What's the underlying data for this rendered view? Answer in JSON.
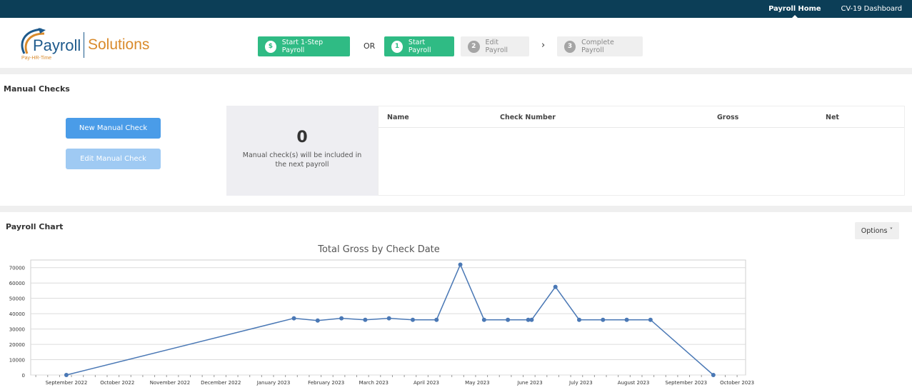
{
  "topnav": {
    "payroll_home": "Payroll Home",
    "cv19_dashboard": "CV-19 Dashboard"
  },
  "logo": {
    "word1": "Payroll",
    "word2": "Solutions",
    "tagline": "Pay-HR-Time"
  },
  "steps": {
    "one_step": {
      "icon": "$",
      "label": "Start 1-Step Payroll"
    },
    "or": "OR",
    "start": {
      "num": "1",
      "label": "Start Payroll"
    },
    "edit": {
      "num": "2",
      "label": "Edit Payroll"
    },
    "chevron": "›",
    "complete": {
      "num": "3",
      "label": "Complete Payroll"
    }
  },
  "manual_checks": {
    "title": "Manual Checks",
    "new_button": "New Manual Check",
    "edit_button": "Edit Manual Check",
    "count": "0",
    "description": "Manual check(s) will be included in the next payroll",
    "columns": [
      "Name",
      "Check Number",
      "Gross",
      "Net"
    ]
  },
  "payroll_chart": {
    "title": "Payroll Chart",
    "options_label": "Options ˅"
  },
  "colors": {
    "topbar": "#0c3e57",
    "green": "#2fbb84",
    "blue": "#4a9ce8",
    "line": "#4a78b5"
  },
  "chart_data": {
    "type": "line",
    "title": "Total Gross by Check Date",
    "xlabel": "",
    "ylabel": "",
    "ylim": [
      0,
      75000
    ],
    "yticks": [
      0,
      10000,
      20000,
      30000,
      40000,
      50000,
      60000,
      70000
    ],
    "grid": true,
    "xticks": [
      "September 2022",
      "October 2022",
      "November 2022",
      "December 2022",
      "January 2023",
      "February 2023",
      "March 2023",
      "April 2023",
      "May 2023",
      "June 2023",
      "July 2023",
      "August 2023",
      "September 2023",
      "October 2023"
    ],
    "series": [
      {
        "x": [
          "2022-09-15",
          "2023-01-27",
          "2023-02-10",
          "2023-02-24",
          "2023-03-10",
          "2023-03-24",
          "2023-04-07",
          "2023-04-21",
          "2023-05-05",
          "2023-05-19",
          "2023-06-02",
          "2023-06-14",
          "2023-06-16",
          "2023-06-30",
          "2023-07-14",
          "2023-07-28",
          "2023-08-11",
          "2023-08-25",
          "2023-10-01"
        ],
        "values": [
          0,
          37000,
          35500,
          37000,
          36000,
          37000,
          36000,
          36000,
          72000,
          36000,
          36000,
          36000,
          36000,
          57500,
          36000,
          36000,
          36000,
          36000,
          0
        ]
      }
    ]
  }
}
